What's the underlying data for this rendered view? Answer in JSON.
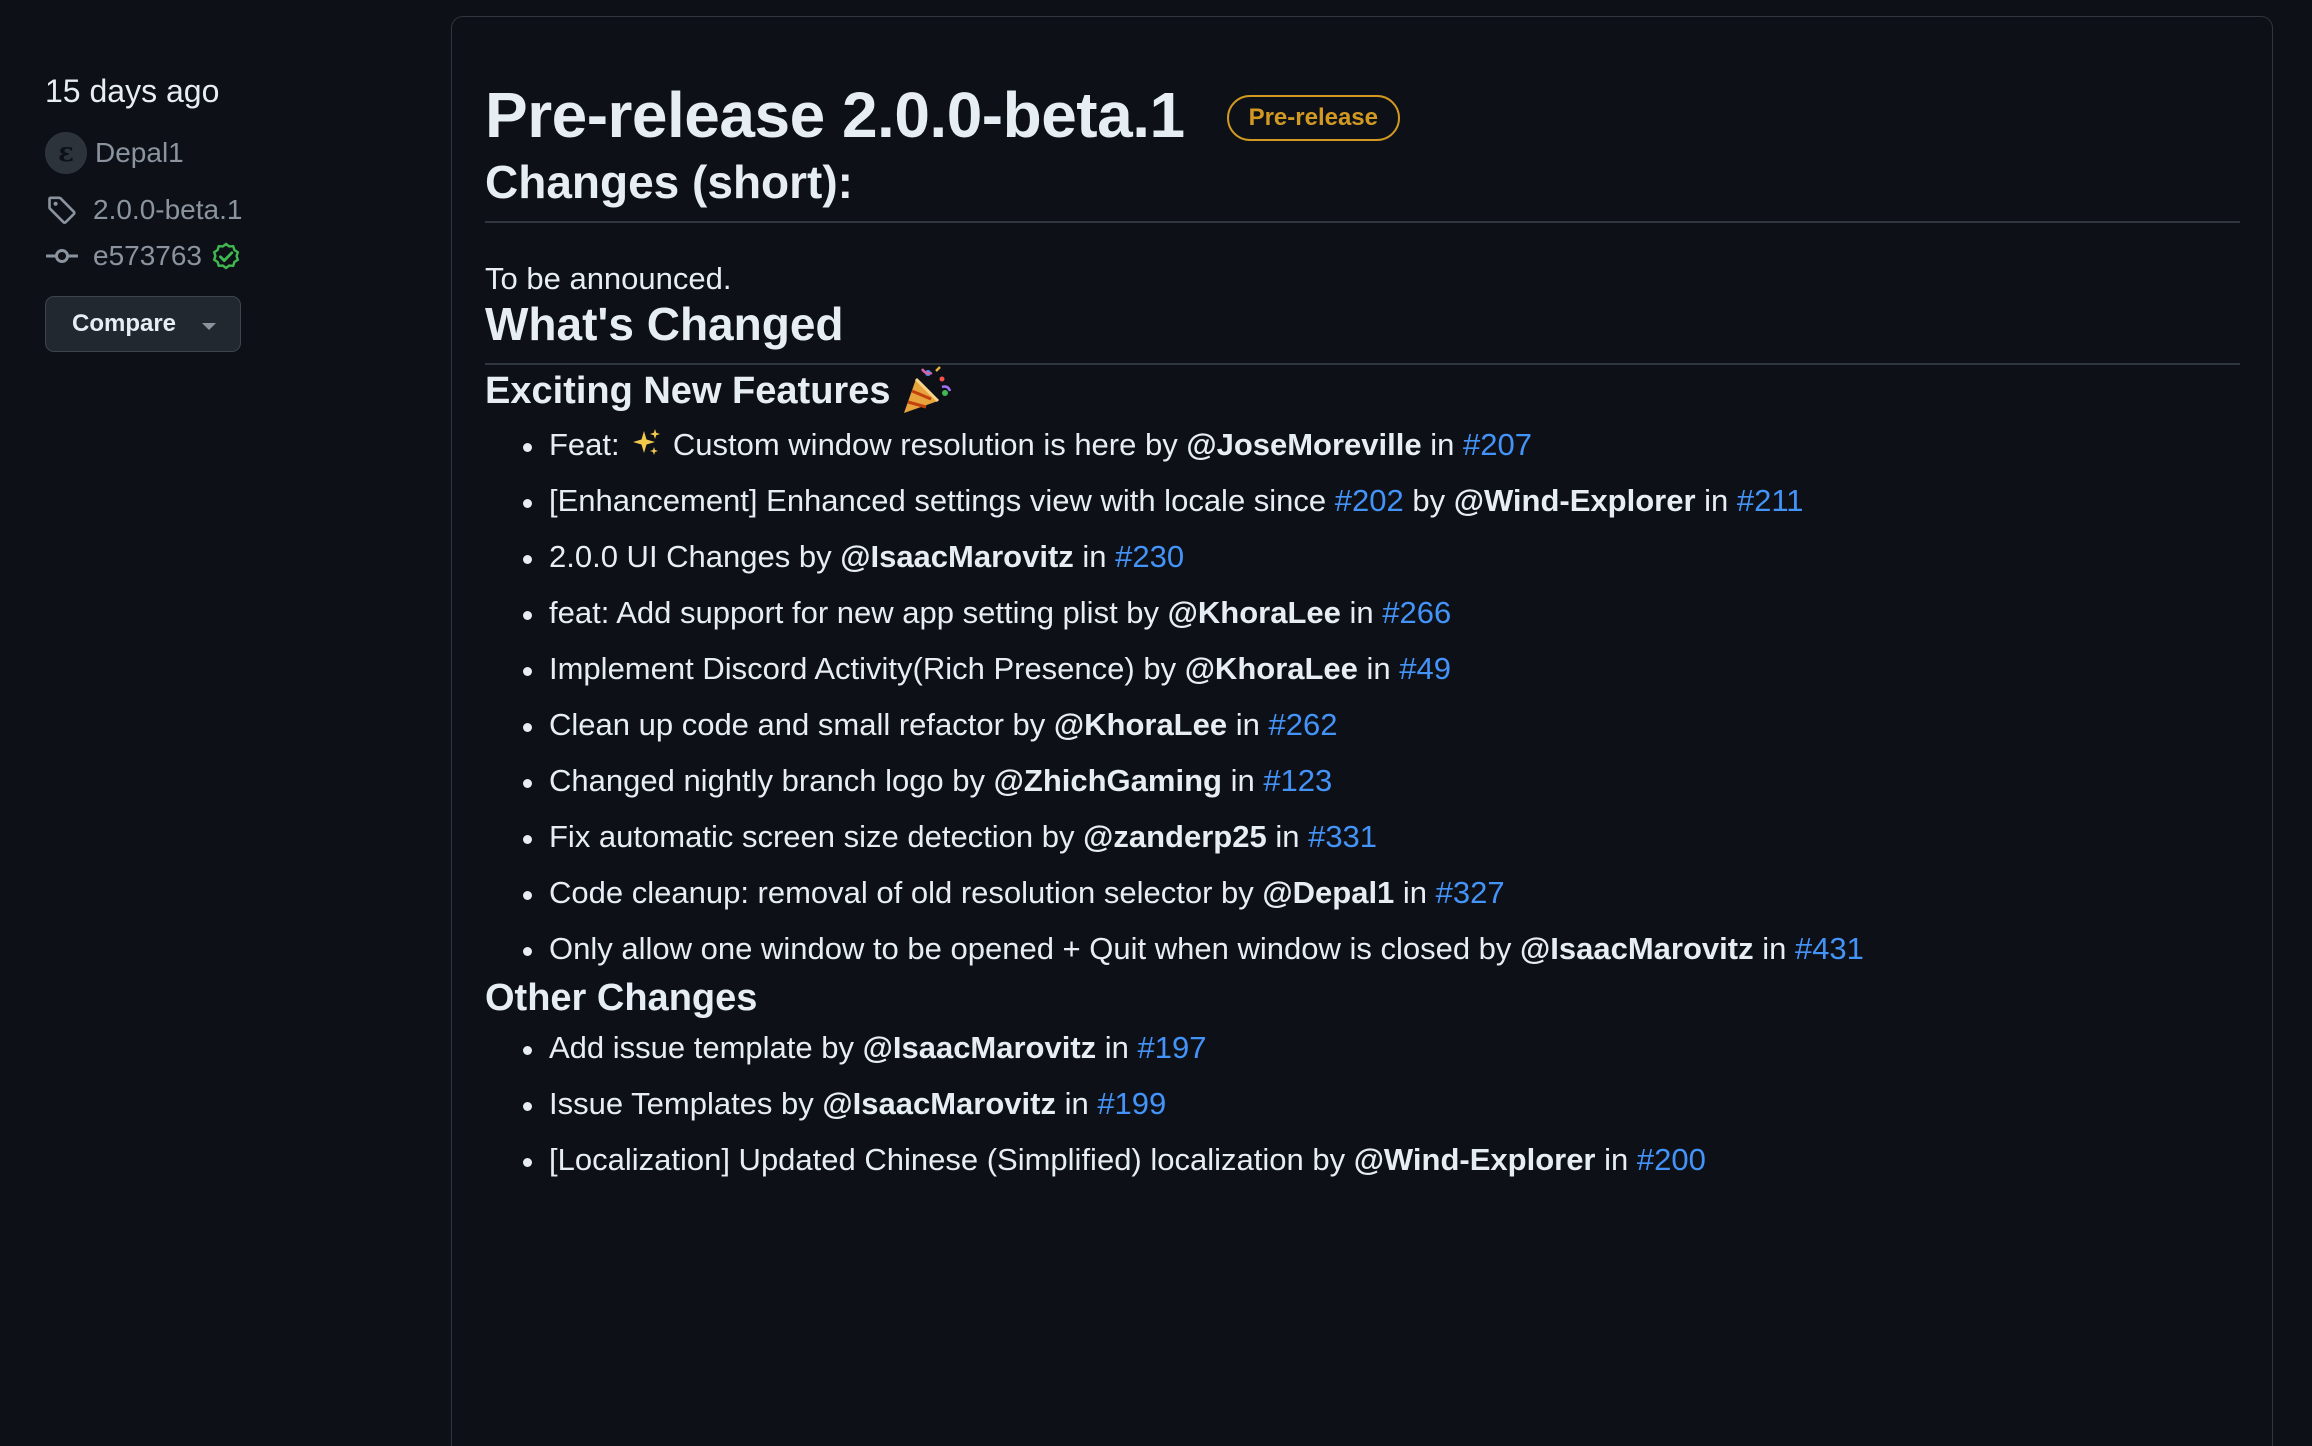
{
  "sidebar": {
    "date": "15 days ago",
    "author": "Depal1",
    "avatar_letter": "ε",
    "tag": "2.0.0-beta.1",
    "commit": "e573763",
    "compare_label": "Compare"
  },
  "release": {
    "title": "Pre-release 2.0.0-beta.1",
    "badge": "Pre-release",
    "badge_color": "#d29922",
    "link_color": "#4493f8"
  },
  "notes": {
    "changes_short_heading": "Changes (short):",
    "changes_short_text": "To be announced.",
    "whats_changed_heading": "What's Changed",
    "features_heading": "Exciting New Features",
    "features": [
      {
        "pre": "Feat: ",
        "icon": "sparkles-icon",
        "text": " Custom window resolution is here by ",
        "user": "@JoseMoreville",
        "mid": " in ",
        "pr": "#207"
      },
      {
        "pre": "[Enhancement] Enhanced settings view with locale since ",
        "ref": "#202",
        "text": " by ",
        "user": "@Wind-Explorer",
        "mid": " in ",
        "pr": "#211"
      },
      {
        "text": "2.0.0 UI Changes by ",
        "user": "@IsaacMarovitz",
        "mid": " in ",
        "pr": "#230"
      },
      {
        "text": "feat: Add support for new app setting plist by ",
        "user": "@KhoraLee",
        "mid": " in ",
        "pr": "#266"
      },
      {
        "text": "Implement Discord Activity(Rich Presence) by ",
        "user": "@KhoraLee",
        "mid": " in ",
        "pr": "#49"
      },
      {
        "text": "Clean up code and small refactor by ",
        "user": "@KhoraLee",
        "mid": " in ",
        "pr": "#262"
      },
      {
        "text": "Changed nightly branch logo by ",
        "user": "@ZhichGaming",
        "mid": " in ",
        "pr": "#123"
      },
      {
        "text": "Fix automatic screen size detection by ",
        "user": "@zanderp25",
        "mid": " in ",
        "pr": "#331"
      },
      {
        "text": "Code cleanup: removal of old resolution selector by ",
        "user": "@Depal1",
        "mid": " in ",
        "pr": "#327"
      },
      {
        "text": "Only allow one window to be opened + Quit when window is closed by ",
        "user": "@IsaacMarovitz",
        "mid": " in ",
        "pr": "#431"
      }
    ],
    "other_heading": "Other Changes",
    "other": [
      {
        "text": "Add issue template by ",
        "user": "@IsaacMarovitz",
        "mid": " in ",
        "pr": "#197"
      },
      {
        "text": "Issue Templates by ",
        "user": "@IsaacMarovitz",
        "mid": " in ",
        "pr": "#199"
      },
      {
        "text": "[Localization] Updated Chinese (Simplified) localization by ",
        "user": "@Wind-Explorer",
        "mid": " in ",
        "pr": "#200"
      }
    ]
  }
}
